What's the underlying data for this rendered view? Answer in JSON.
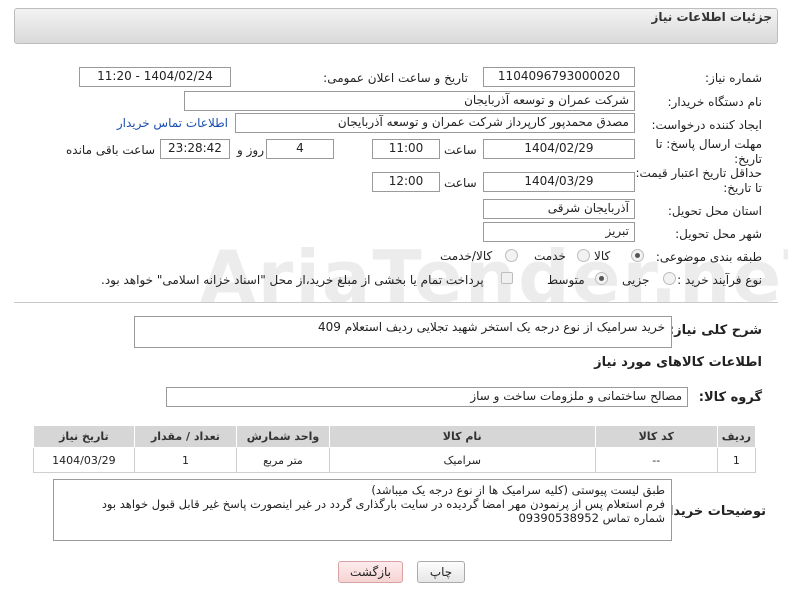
{
  "header": {
    "title": "جزئیات اطلاعات نیاز"
  },
  "fields": {
    "need_number_label": "شماره نیاز:",
    "need_number": "1104096793000020",
    "announce_label": "تاریخ و ساعت اعلان عمومی:",
    "announce_value": "1404/02/24 - 11:20",
    "buyer_org_label": "نام دستگاه خریدار:",
    "buyer_org": "شرکت عمران و توسعه آذربایجان",
    "requester_label": "ایجاد کننده درخواست:",
    "requester": "مصدق محمدپور کارپرداز شرکت عمران و توسعه آذربایجان",
    "buyer_contact_link": "اطلاعات تماس خریدار",
    "deadline_label": "مهلت ارسال پاسخ: تا تاریخ:",
    "deadline_date": "1404/02/29",
    "hour_label": "ساعت",
    "deadline_time": "11:00",
    "days_value": "4",
    "days_label": "روز و",
    "remaining_time": "23:28:42",
    "remaining_label": "ساعت باقی مانده",
    "validity_label": "حداقل تاریخ اعتبار قیمت: تا تاریخ:",
    "validity_date": "1404/03/29",
    "validity_time": "12:00",
    "province_label": "استان محل تحویل:",
    "province": "آذربایجان شرقی",
    "city_label": "شهر محل تحویل:",
    "city": "تبریز",
    "category_label": "طبقه بندی موضوعی:",
    "category_options": [
      "کالا",
      "خدمت",
      "کالا/خدمت"
    ],
    "process_label": "نوع فرآیند خرید :",
    "process_options": [
      "جزیی",
      "متوسط"
    ],
    "payment_note": "پرداخت تمام یا بخشی از مبلغ خرید،از محل \"اسناد خزانه اسلامی\" خواهد بود.",
    "description_label": "شرح کلی نیاز:",
    "description": "خرید سرامیک  از نوع درجه یک  استخر شهید تجلایی ردیف استعلام 409",
    "goods_info_title": "اطلاعات کالاهای مورد نیاز",
    "goods_group_label": "گروه کالا:",
    "goods_group": "مصالح ساختمانی و ملزومات ساخت و ساز"
  },
  "table": {
    "headers": [
      "ردیف",
      "کد کالا",
      "نام کالا",
      "واحد شمارش",
      "تعداد / مقدار",
      "تاریخ نیاز"
    ],
    "rows": [
      [
        "1",
        "--",
        "سرامیک",
        "متر مربع",
        "1",
        "1404/03/29"
      ]
    ]
  },
  "buyer_notes": {
    "label": "توضیحات خریدار:",
    "line1": "طبق لیست پیوستی (کلیه سرامیک ها از نوع درجه یک میباشد)",
    "line2": "فرم استعلام پس از پرنمودن مهر امضا گردیده در سایت بارگذاری گردد  در غیر اینصورت پاسخ غیر قابل قبول خواهد بود",
    "line3": "شماره تماس 09390538952"
  },
  "buttons": {
    "print": "چاپ",
    "back": "بازگشت"
  }
}
